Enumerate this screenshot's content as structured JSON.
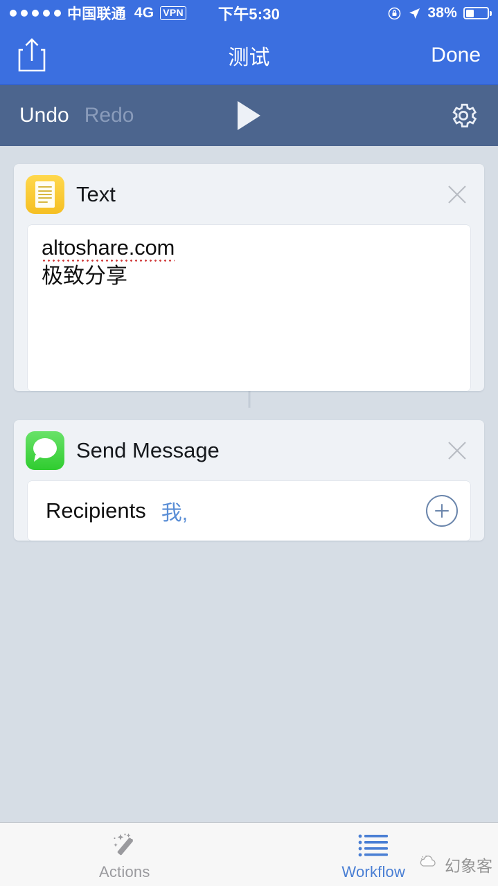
{
  "statusbar": {
    "signal_dots": 5,
    "carrier": "中国联通",
    "network": "4G",
    "vpn": "VPN",
    "time": "下午5:30",
    "battery_percent": "38%",
    "battery_level": 38,
    "rotation_lock_icon": "rotation-lock-icon",
    "location_icon": "location-arrow-icon",
    "bg_color": "#3b6fe0"
  },
  "navbar": {
    "share_icon": "share-icon",
    "title": "测试",
    "done_label": "Done"
  },
  "toolbar": {
    "undo_label": "Undo",
    "redo_label": "Redo",
    "redo_disabled": true,
    "play_icon": "play-icon",
    "settings_icon": "gear-icon",
    "bg_color": "#4c658e"
  },
  "actions": [
    {
      "name": "Text",
      "icon": "text-document-icon",
      "icon_color": "#f5bf23",
      "close_icon": "close-icon",
      "text_value": "altoshare.com\n极致分享",
      "text_line1": "altoshare.com",
      "text_line2": "极致分享",
      "spellcheck_underline": true,
      "spellcheck_color": "#d03a3a"
    },
    {
      "name": "Send Message",
      "icon": "message-bubble-icon",
      "icon_color": "#2fcc2f",
      "close_icon": "close-icon",
      "field_label": "Recipients",
      "field_value": "我,",
      "field_value_color": "#5a8ed6",
      "add_icon": "plus-circle-icon"
    }
  ],
  "tabbar": {
    "tabs": [
      {
        "label": "Actions",
        "icon": "magic-wand-icon",
        "active": false
      },
      {
        "label": "Workflow",
        "icon": "list-icon",
        "active": true
      }
    ],
    "accent_color": "#4a7fd4"
  },
  "watermark": {
    "text": "幻象客",
    "icon": "watermark-logo-icon"
  }
}
